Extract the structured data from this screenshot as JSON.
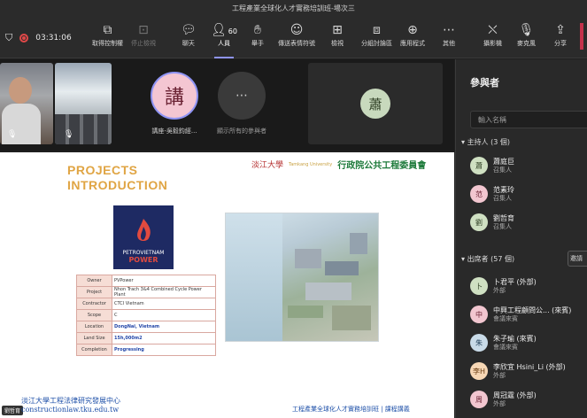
{
  "window": {
    "title": "工程產業全球化人才實務培訓班-場次三"
  },
  "toolbar": {
    "timer": "03:31:06",
    "buttons": [
      {
        "label": "取得控制權",
        "icon": "screen-control-icon"
      },
      {
        "label": "停止檢視",
        "icon": "stop-view-icon"
      },
      {
        "label": "聊天",
        "icon": "chat-icon"
      },
      {
        "label": "人員",
        "icon": "people-icon",
        "count": "60"
      },
      {
        "label": "舉手",
        "icon": "raise-hand-icon"
      },
      {
        "label": "傳送表情符號",
        "icon": "emoji-icon"
      },
      {
        "label": "檢視",
        "icon": "view-icon"
      },
      {
        "label": "分組討論區",
        "icon": "breakout-icon"
      },
      {
        "label": "應用程式",
        "icon": "apps-icon"
      },
      {
        "label": "其他",
        "icon": "more-icon"
      },
      {
        "label": "攝影機",
        "icon": "camera-off-icon"
      },
      {
        "label": "麥克風",
        "icon": "mic-off-icon"
      },
      {
        "label": "分享",
        "icon": "share-icon"
      }
    ]
  },
  "strip": {
    "speaker_avatar": "講",
    "speaker_name": "講座-吳毅鈞經...",
    "others_label": "顯示所有的參與者",
    "big_avatar": "蕭"
  },
  "slide": {
    "title_line1": "PROJECTS",
    "title_line2": "INTRODUCTION",
    "logo_left": "淡江大學",
    "logo_mid": "Tamkang University",
    "logo_right": "行政院公共工程委員會",
    "pv_line1": "PETROVIETNAM",
    "pv_line2": "POWER",
    "table": [
      {
        "k": "Owner",
        "v": "PVPower",
        "blue": false
      },
      {
        "k": "Project",
        "v": "Nhon Trach 3&4 Combined Cycle Power Plant",
        "blue": false
      },
      {
        "k": "Contractor",
        "v": "CTCI Vietnam",
        "blue": false
      },
      {
        "k": "Scope",
        "v": "C",
        "blue": false
      },
      {
        "k": "Location",
        "v": "DongNai, Vietnam",
        "blue": true
      },
      {
        "k": "Land Size",
        "v": "15h,000m2",
        "blue": true
      },
      {
        "k": "Completion",
        "v": "Progressing",
        "blue": true
      }
    ],
    "footer_left1": "淡江大學工程法律研究發展中心",
    "footer_left2": "constructionlaw.tku.edu.tw",
    "footer_right": "工程產業全球化人才實務培訓班 | 課程講義",
    "footer_badge": "劉哲育"
  },
  "panel": {
    "title": "參與者",
    "search_placeholder": "輸入名稱",
    "organizers_header": "主持人 (3 個)",
    "organizers": [
      {
        "avatar": "蕭",
        "name": "蕭庭巨",
        "role": "召集人",
        "color": "#cfe0c2",
        "fg": "#2f3f24"
      },
      {
        "avatar": "范",
        "name": "范素玲",
        "role": "召集人",
        "color": "#f2c6d0",
        "fg": "#6a2233"
      },
      {
        "avatar": "劉",
        "name": "劉哲育",
        "role": "召集人",
        "color": "#cfe0c2",
        "fg": "#2f3f24"
      }
    ],
    "attendees_header": "出席者 (57 個)",
    "invite_label": "邀請",
    "attendees": [
      {
        "avatar": "卜",
        "name": "卜君平 (外部)",
        "role": "外部",
        "color": "#cfe0c2",
        "fg": "#2f3f24"
      },
      {
        "avatar": "中",
        "name": "中興工程顧問公... (來賓)",
        "role": "會議來賓",
        "color": "#f2c6d0",
        "fg": "#6a2233"
      },
      {
        "avatar": "朱",
        "name": "朱子瑜 (來賓)",
        "role": "會議來賓",
        "color": "#c9dbe8",
        "fg": "#23415a"
      },
      {
        "avatar": "李H",
        "name": "李欣宜 Hsini_Li (外部)",
        "role": "外部",
        "color": "#f7d7b5",
        "fg": "#6b3d12"
      },
      {
        "avatar": "周",
        "name": "周冠霆 (外部)",
        "role": "外部",
        "color": "#f2c6d0",
        "fg": "#6a2233"
      }
    ]
  }
}
